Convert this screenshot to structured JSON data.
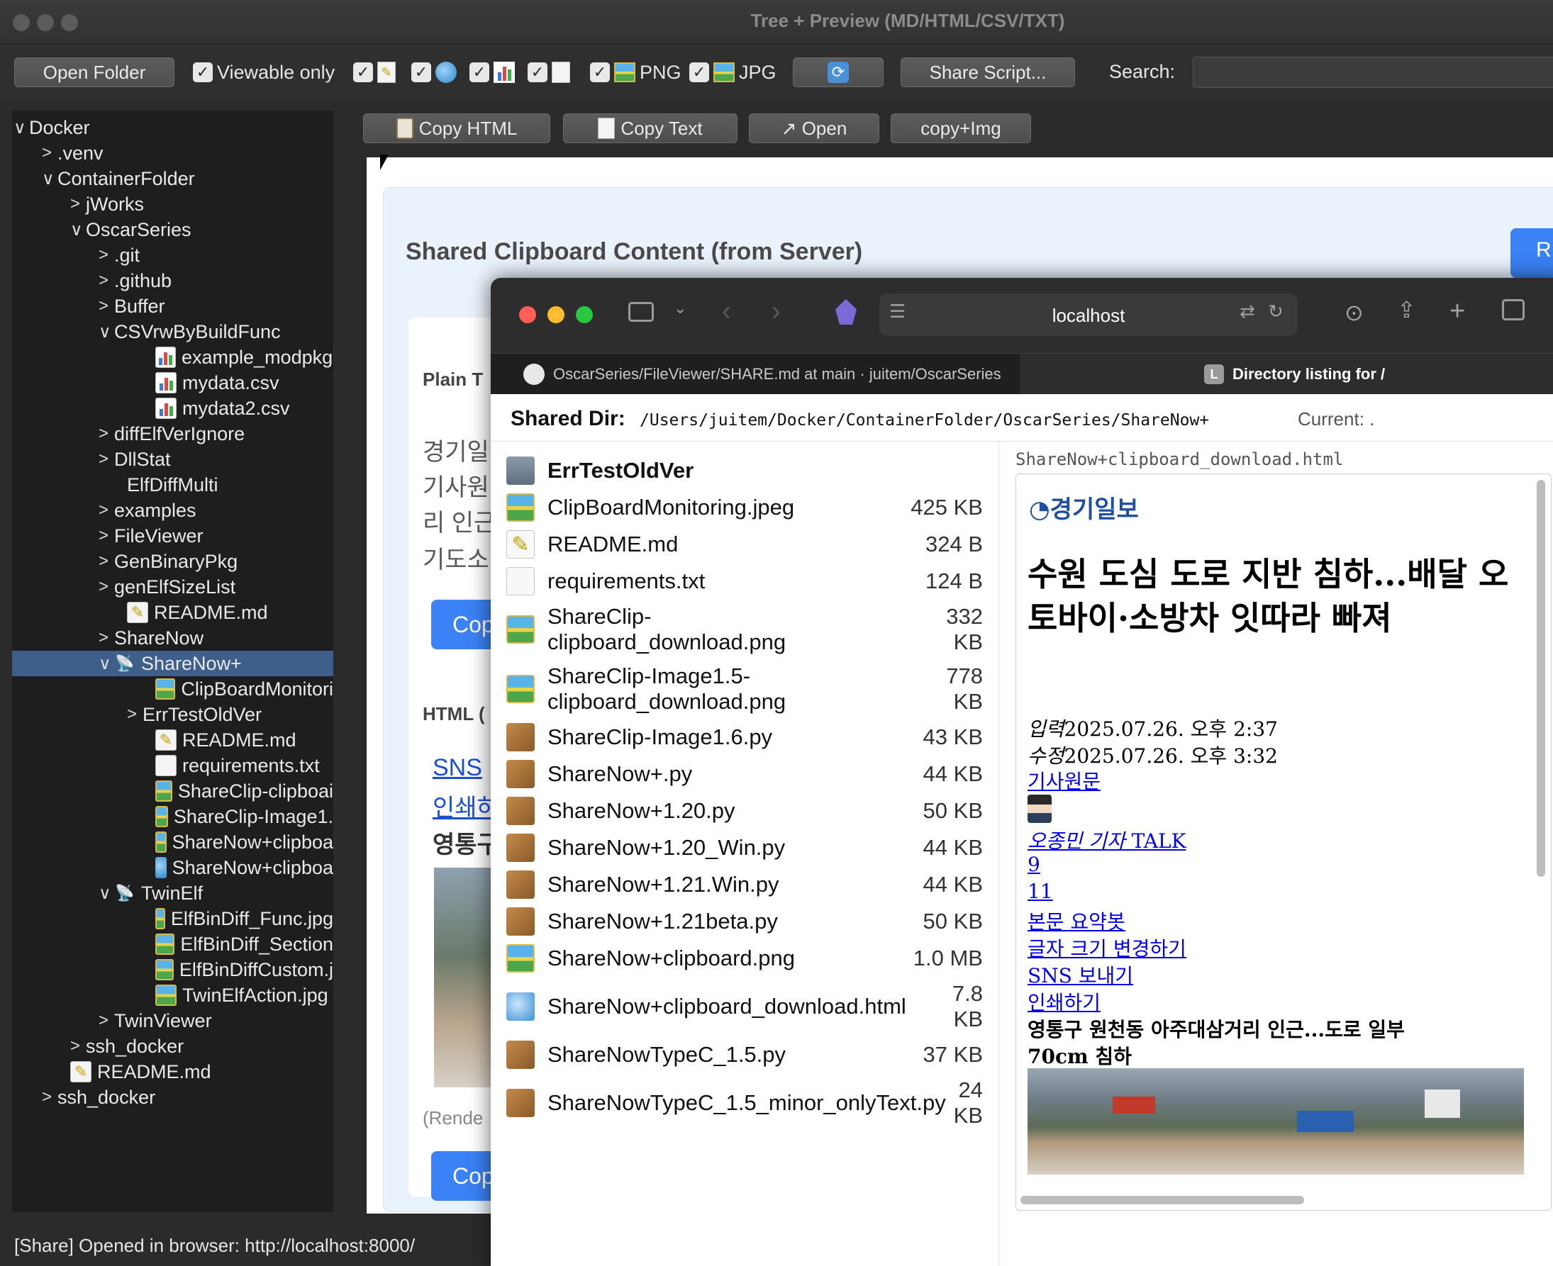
{
  "window": {
    "title": "Tree + Preview (MD/HTML/CSV/TXT)"
  },
  "toolbar": {
    "open_folder": "Open Folder",
    "viewable_only": "Viewable only",
    "png_label": "PNG",
    "jpg_label": "JPG",
    "share_script": "Share Script...",
    "search_label": "Search:",
    "search_value": ""
  },
  "preview_toolbar": {
    "copy_html": "Copy HTML",
    "copy_text": "Copy Text",
    "open": "↗ Open",
    "copy_img": "copy+Img"
  },
  "tree": [
    {
      "label": "Docker",
      "level": 0,
      "arrow": "v",
      "icon": ""
    },
    {
      "label": ".venv",
      "level": 1,
      "arrow": ">",
      "icon": ""
    },
    {
      "label": "ContainerFolder",
      "level": 1,
      "arrow": "v",
      "icon": ""
    },
    {
      "label": "jWorks",
      "level": 2,
      "arrow": ">",
      "icon": ""
    },
    {
      "label": "OscarSeries",
      "level": 2,
      "arrow": "v",
      "icon": ""
    },
    {
      "label": ".git",
      "level": 3,
      "arrow": ">",
      "icon": ""
    },
    {
      "label": ".github",
      "level": 3,
      "arrow": ">",
      "icon": ""
    },
    {
      "label": "Buffer",
      "level": 3,
      "arrow": ">",
      "icon": ""
    },
    {
      "label": "CSVrwByBuildFunc",
      "level": 3,
      "arrow": "v",
      "icon": ""
    },
    {
      "label": "example_modpkg.",
      "level": 5,
      "arrow": "",
      "icon": "csv"
    },
    {
      "label": "mydata.csv",
      "level": 5,
      "arrow": "",
      "icon": "csv"
    },
    {
      "label": "mydata2.csv",
      "level": 5,
      "arrow": "",
      "icon": "csv"
    },
    {
      "label": "diffElfVerIgnore",
      "level": 3,
      "arrow": ">",
      "icon": ""
    },
    {
      "label": "DllStat",
      "level": 3,
      "arrow": ">",
      "icon": ""
    },
    {
      "label": "ElfDiffMulti",
      "level": 4,
      "arrow": "",
      "icon": ""
    },
    {
      "label": "examples",
      "level": 3,
      "arrow": ">",
      "icon": ""
    },
    {
      "label": "FileViewer",
      "level": 3,
      "arrow": ">",
      "icon": ""
    },
    {
      "label": "GenBinaryPkg",
      "level": 3,
      "arrow": ">",
      "icon": ""
    },
    {
      "label": "genElfSizeList",
      "level": 3,
      "arrow": ">",
      "icon": ""
    },
    {
      "label": "README.md",
      "level": 4,
      "arrow": "",
      "icon": "md"
    },
    {
      "label": "ShareNow",
      "level": 3,
      "arrow": ">",
      "icon": ""
    },
    {
      "label": "ShareNow+",
      "level": 3,
      "arrow": "v",
      "icon": "sat",
      "selected": true
    },
    {
      "label": "ClipBoardMonitori",
      "level": 5,
      "arrow": "",
      "icon": "img"
    },
    {
      "label": "ErrTestOldVer",
      "level": 4,
      "arrow": ">",
      "icon": ""
    },
    {
      "label": "README.md",
      "level": 5,
      "arrow": "",
      "icon": "md"
    },
    {
      "label": "requirements.txt",
      "level": 5,
      "arrow": "",
      "icon": "txt"
    },
    {
      "label": "ShareClip-clipboai",
      "level": 5,
      "arrow": "",
      "icon": "img"
    },
    {
      "label": "ShareClip-Image1.",
      "level": 5,
      "arrow": "",
      "icon": "img"
    },
    {
      "label": "ShareNow+clipboa",
      "level": 5,
      "arrow": "",
      "icon": "img"
    },
    {
      "label": "ShareNow+clipboa",
      "level": 5,
      "arrow": "",
      "icon": "globe"
    },
    {
      "label": "TwinElf",
      "level": 3,
      "arrow": "v",
      "icon": "sat"
    },
    {
      "label": "ElfBinDiff_Func.jpg",
      "level": 5,
      "arrow": "",
      "icon": "img"
    },
    {
      "label": "ElfBinDiff_Section",
      "level": 5,
      "arrow": "",
      "icon": "img"
    },
    {
      "label": "ElfBinDiffCustom.j",
      "level": 5,
      "arrow": "",
      "icon": "img"
    },
    {
      "label": "TwinElfAction.jpg",
      "level": 5,
      "arrow": "",
      "icon": "img"
    },
    {
      "label": "TwinViewer",
      "level": 3,
      "arrow": ">",
      "icon": ""
    },
    {
      "label": "ssh_docker",
      "level": 2,
      "arrow": ">",
      "icon": ""
    },
    {
      "label": "README.md",
      "level": 2,
      "arrow": "",
      "icon": "md"
    },
    {
      "label": "ssh_docker",
      "level": 1,
      "arrow": ">",
      "icon": ""
    }
  ],
  "preview": {
    "heading": "Shared Clipboard Content (from Server)",
    "plain_label": "Plain T",
    "korean_lines": [
      "경기일",
      "기사원",
      "리 인근",
      "기도소"
    ],
    "copy_btn": "Cop",
    "html_label": "HTML (",
    "sns_link": "SNS",
    "print_link": "인쇄하",
    "region": "영통구",
    "render_note": "(Rende",
    "copy_btn2": "Cop",
    "r_btn": "R"
  },
  "status": {
    "text": "[Share] Opened in browser: http://localhost:8000/"
  },
  "safari": {
    "url": "localhost",
    "tabs": [
      {
        "label": "OscarSeries/FileViewer/SHARE.md at main · juitem/OscarSeries",
        "icon": "github"
      },
      {
        "label": "Directory listing for /",
        "icon": "L"
      }
    ],
    "shared_dir_label": "Shared Dir:",
    "shared_dir_path": "/Users/juitem/Docker/ContainerFolder/OscarSeries/ShareNow+",
    "current_label": "Current: .",
    "files": [
      {
        "name": "ErrTestOldVer",
        "size": "",
        "icon": "folder",
        "bold": true
      },
      {
        "name": "ClipBoardMonitoring.jpeg",
        "size": "425 KB",
        "icon": "img"
      },
      {
        "name": "README.md",
        "size": "324 B",
        "icon": "md"
      },
      {
        "name": "requirements.txt",
        "size": "124 B",
        "icon": "txt"
      },
      {
        "name": "ShareClip-\nclipboard_download.png",
        "size": "332\nKB",
        "icon": "img"
      },
      {
        "name": "ShareClip-Image1.5-\nclipboard_download.png",
        "size": "778\nKB",
        "icon": "img"
      },
      {
        "name": "ShareClip-Image1.6.py",
        "size": "43 KB",
        "icon": "py"
      },
      {
        "name": "ShareNow+.py",
        "size": "44 KB",
        "icon": "py"
      },
      {
        "name": "ShareNow+1.20.py",
        "size": "50 KB",
        "icon": "py"
      },
      {
        "name": "ShareNow+1.20_Win.py",
        "size": "44 KB",
        "icon": "py"
      },
      {
        "name": "ShareNow+1.21.Win.py",
        "size": "44 KB",
        "icon": "py"
      },
      {
        "name": "ShareNow+1.21beta.py",
        "size": "50 KB",
        "icon": "py"
      },
      {
        "name": "ShareNow+clipboard.png",
        "size": "1.0 MB",
        "icon": "img"
      },
      {
        "name": "ShareNow+clipboard_download.html",
        "size": "7.8\nKB",
        "icon": "html"
      },
      {
        "name": "ShareNowTypeC_1.5.py",
        "size": "37 KB",
        "icon": "py"
      },
      {
        "name": "ShareNowTypeC_1.5_minor_onlyText.py",
        "size": "24\nKB",
        "icon": "py"
      }
    ],
    "preview_filename": "ShareNow+clipboard_download.html",
    "article": {
      "logo": "경기일보",
      "headline": "수원 도심 도로 지반 침하...배달 오토바이·소방차 잇따라 빠져",
      "input_label": "입력",
      "input_date": "2025.07.26. 오후 2:37",
      "edit_label": "수정",
      "edit_date": "2025.07.26. 오후 3:32",
      "source_link": "기사원문",
      "reporter_name": "오종민 기자",
      "reporter_talk": " TALK",
      "count1": "9",
      "count2": "11",
      "summary": "본문 요약봇",
      "font_size": "글자 크기 변경하기",
      "sns": "SNS 보내기",
      "print": "인쇄하기",
      "caption1": "영통구 원천동 아주대삼거리 인근...도로 일부",
      "caption2": "70cm 침하"
    }
  }
}
